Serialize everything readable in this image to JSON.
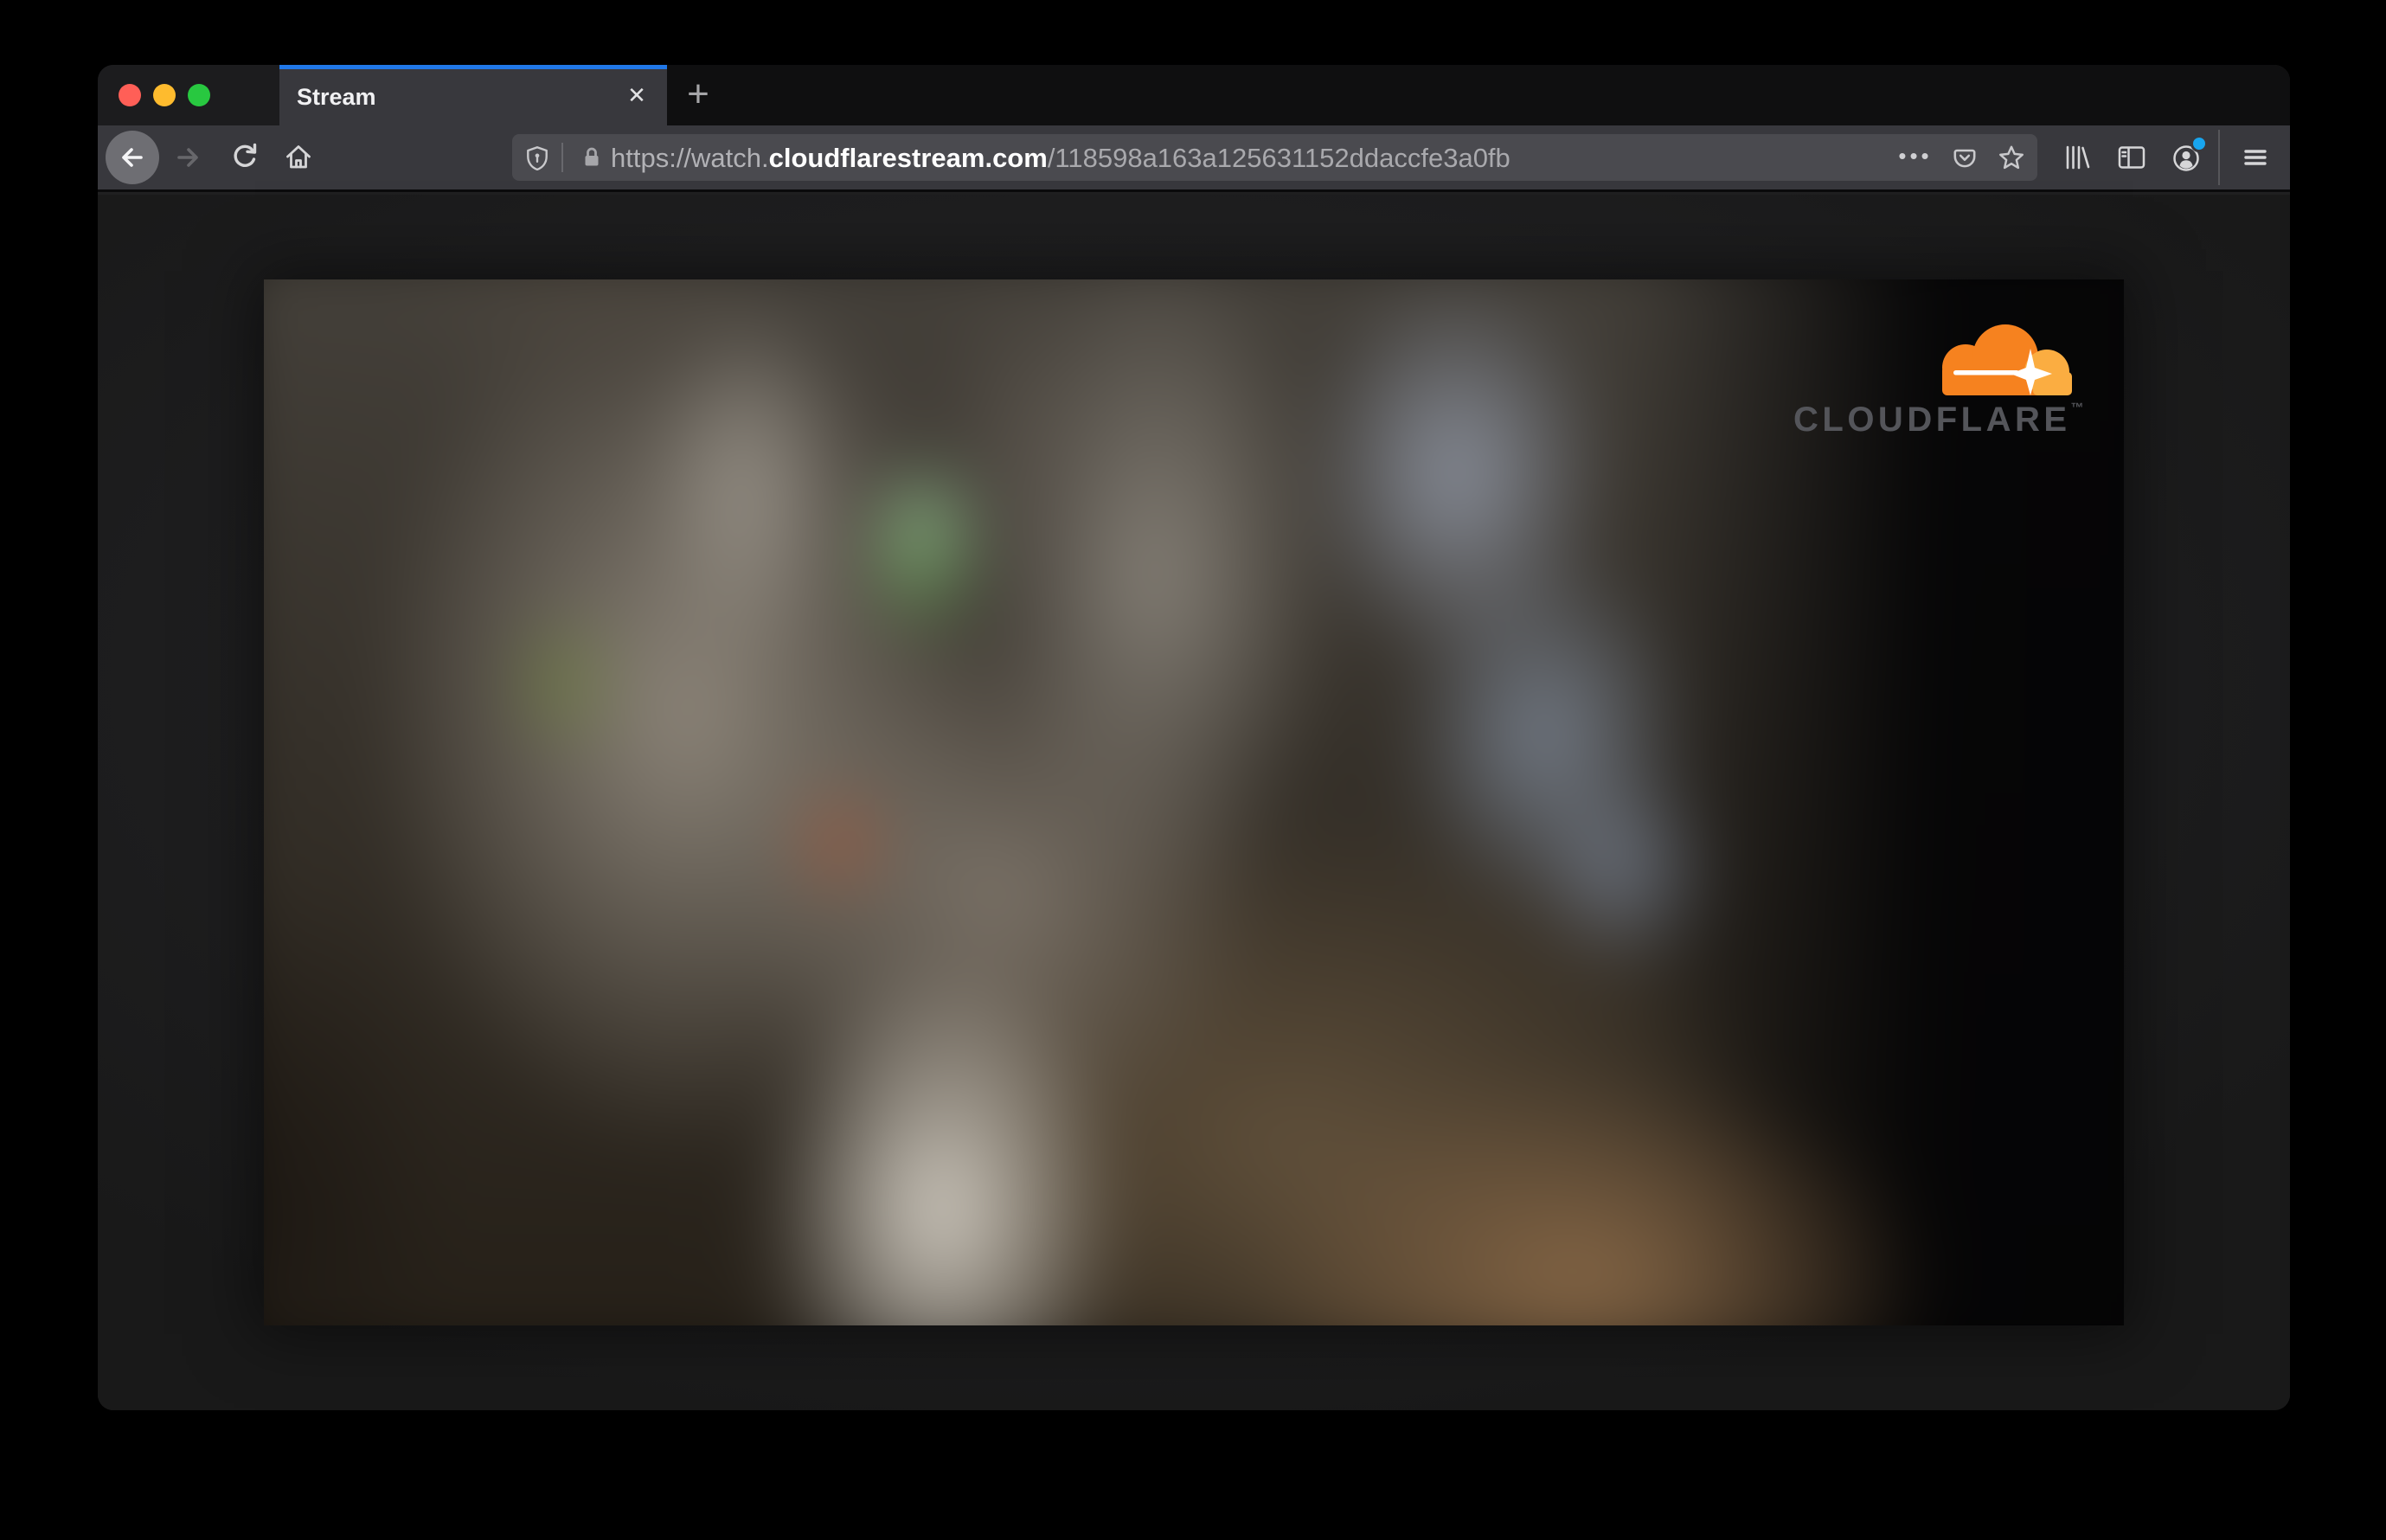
{
  "window_controls": {
    "close": "close",
    "minimize": "minimize",
    "zoom": "zoom"
  },
  "tab_bar": {
    "tab_title": "Stream",
    "close_glyph": "✕",
    "new_tab_glyph": "+"
  },
  "navbar": {
    "url": {
      "prefix": "https://watch.",
      "domain": "cloudflarestream.com",
      "path": "/118598a163a125631152ddaccfe3a0fb"
    },
    "page_actions_glyph": "•••"
  },
  "video": {
    "brand_text": "CLOUDFLARE",
    "brand_mark": "™"
  },
  "icons": [
    "back-icon",
    "forward-icon",
    "reload-icon",
    "home-icon",
    "shield-icon",
    "lock-icon",
    "page-actions-icon",
    "pocket-icon",
    "bookmark-star-icon",
    "library-icon",
    "sidebar-icon",
    "account-icon",
    "menu-icon",
    "cloudflare-cloud-icon"
  ],
  "colors": {
    "accent_blue": "#2178e8",
    "traffic_red": "#ff5f57",
    "traffic_yellow": "#febb2e",
    "traffic_green": "#28c840",
    "notification_blue": "#18a5ee",
    "cloud_orange": "#f6821f",
    "cloud_light_orange": "#fbad41",
    "toolbar_bg": "#38383d",
    "urlbar_bg": "#4a4a4f"
  }
}
